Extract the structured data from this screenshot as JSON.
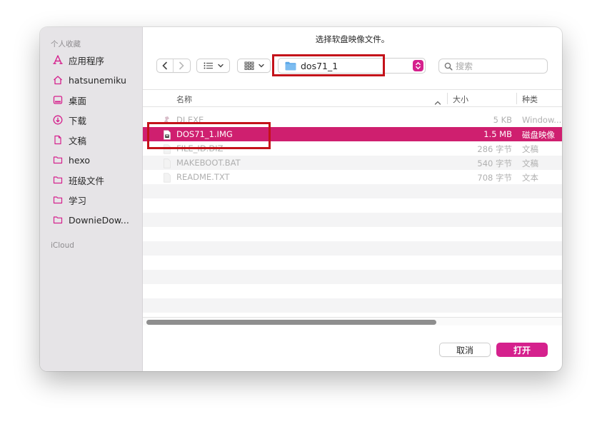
{
  "dialog": {
    "title": "选择软盘映像文件。"
  },
  "sidebar": {
    "favorites_heading": "个人收藏",
    "items": [
      {
        "label": "应用程序",
        "icon": "applications-icon"
      },
      {
        "label": "hatsunemiku",
        "icon": "home-icon"
      },
      {
        "label": "桌面",
        "icon": "desktop-icon"
      },
      {
        "label": "下载",
        "icon": "downloads-icon"
      },
      {
        "label": "文稿",
        "icon": "document-icon"
      },
      {
        "label": "hexo",
        "icon": "folder-icon"
      },
      {
        "label": "班级文件",
        "icon": "folder-icon"
      },
      {
        "label": "学习",
        "icon": "folder-icon"
      },
      {
        "label": "DownieDow...",
        "icon": "folder-icon"
      }
    ],
    "icloud_heading": "iCloud"
  },
  "toolbar": {
    "path_label": "dos71_1",
    "search_placeholder": "搜索"
  },
  "table": {
    "columns": {
      "name": "名称",
      "size": "大小",
      "kind": "种类"
    },
    "rows": [
      {
        "name": "DI.EXE",
        "size": "5 KB",
        "kind": "Window...",
        "selected": false
      },
      {
        "name": "DOS71_1.IMG",
        "size": "1.5 MB",
        "kind": "磁盘映像",
        "selected": true
      },
      {
        "name": "FILE_ID.DIZ",
        "size": "286 字节",
        "kind": "文稿",
        "selected": false
      },
      {
        "name": "MAKEBOOT.BAT",
        "size": "540 字节",
        "kind": "文稿",
        "selected": false
      },
      {
        "name": "README.TXT",
        "size": "708 字节",
        "kind": "文本",
        "selected": false
      }
    ]
  },
  "buttons": {
    "cancel": "取消",
    "open": "打开"
  },
  "colors": {
    "accent": "#d5218d",
    "selection": "#cf1f6f",
    "annotation_box": "#c4121a"
  }
}
